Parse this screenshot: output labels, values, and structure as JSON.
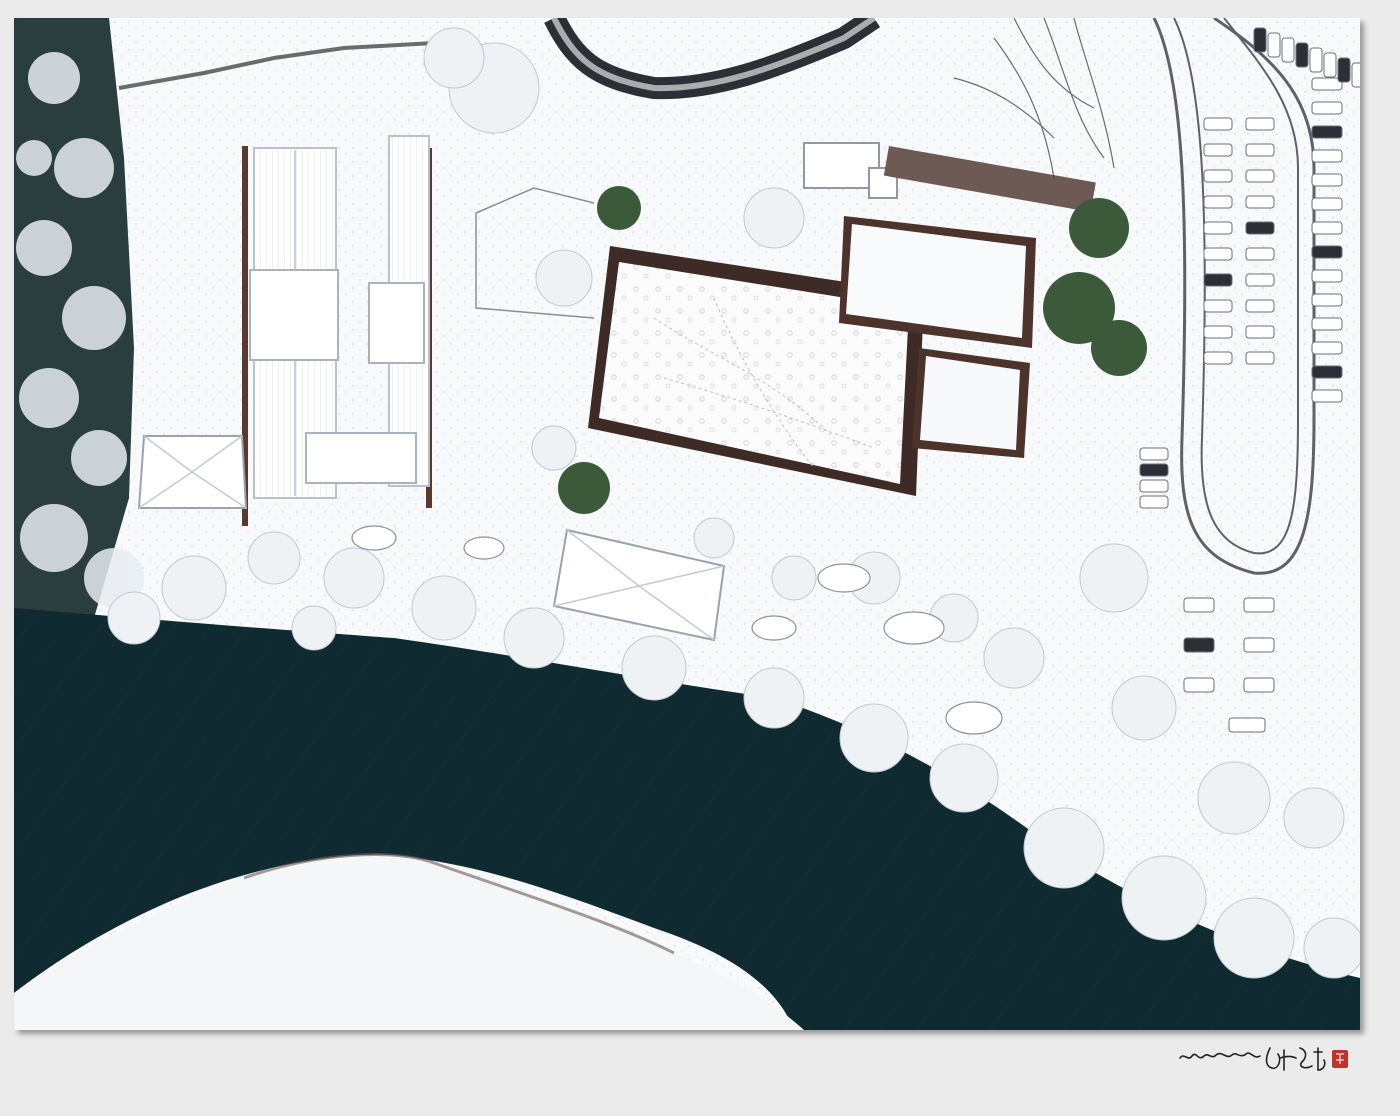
{
  "photo": {
    "subject": "",
    "colors": {
      "snow": "#fbfcfd",
      "snow_shade": "#dde3ea",
      "water": "#0f2a30",
      "water_deep": "#0a1e23",
      "forest": "#1e3434",
      "pine": "#3c5a3a",
      "wall": "#5a3a2e",
      "roof_edge": "#b9c2cc",
      "road": "#2c3036",
      "mat": "#ebebeb"
    }
  },
  "signature": {
    "text": "",
    "seal_color": "#c0332b"
  }
}
